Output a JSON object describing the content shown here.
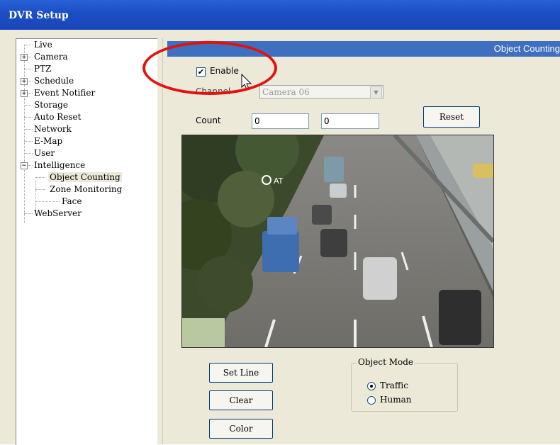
{
  "window": {
    "title": "DVR Setup"
  },
  "tree": {
    "items": [
      {
        "label": "Live",
        "expander": ""
      },
      {
        "label": "Camera",
        "expander": "+"
      },
      {
        "label": "PTZ",
        "expander": ""
      },
      {
        "label": "Schedule",
        "expander": "+"
      },
      {
        "label": "Event Notifier",
        "expander": "+"
      },
      {
        "label": "Storage",
        "expander": ""
      },
      {
        "label": "Auto Reset",
        "expander": ""
      },
      {
        "label": "Network",
        "expander": ""
      },
      {
        "label": "E-Map",
        "expander": ""
      },
      {
        "label": "User",
        "expander": ""
      },
      {
        "label": "Intelligence",
        "expander": "−"
      },
      {
        "label": "Object Counting",
        "expander": "",
        "selected": true
      },
      {
        "label": "Zone Monitoring",
        "expander": ""
      },
      {
        "label": "Face",
        "expander": ""
      },
      {
        "label": "WebServer",
        "expander": ""
      }
    ]
  },
  "panel": {
    "header": "Object Counting",
    "enable": {
      "label": "Enable",
      "checked": true,
      "check_mark": "✔"
    },
    "channel": {
      "label": "Channel",
      "value": "Camera 06",
      "disabled": true,
      "arrow": "▼"
    },
    "count": {
      "label": "Count",
      "value1": "0",
      "value2": "0"
    },
    "reset_button": "Reset",
    "video": {
      "overlay_text": "AT"
    },
    "buttons": {
      "set_line": "Set Line",
      "clear": "Clear",
      "color": "Color"
    },
    "object_mode": {
      "title": "Object Mode",
      "options": [
        {
          "label": "Traffic",
          "selected": true
        },
        {
          "label": "Human",
          "selected": false
        }
      ]
    }
  },
  "colors": {
    "title_bar": "#1c4fc4",
    "panel_header": "#3f6fbf",
    "highlight_oval": "#e01212",
    "face": "#ece9d8"
  },
  "icons": {
    "cursor": "pointer-cursor-icon",
    "video_overlay": "refresh-icon"
  }
}
